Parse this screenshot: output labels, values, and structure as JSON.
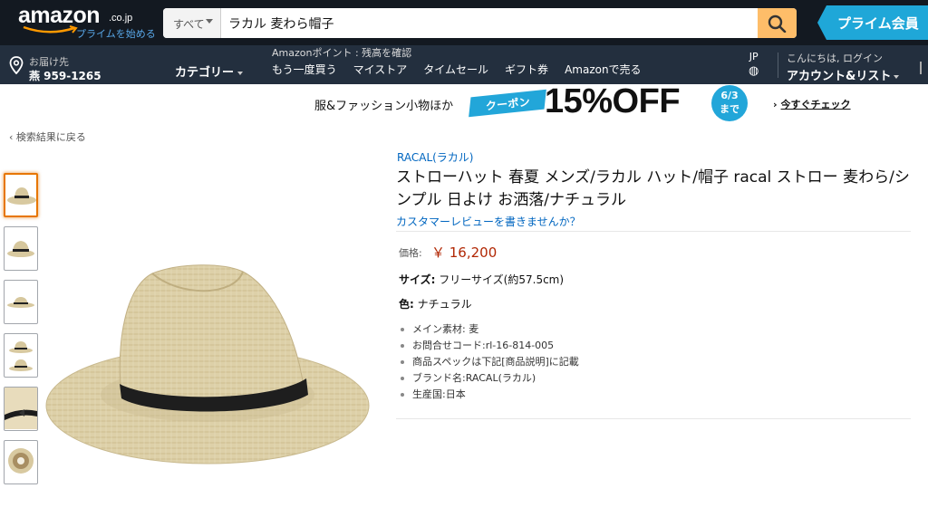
{
  "header": {
    "logo_word": "amazon",
    "logo_tld": ".co.jp",
    "logo_prime_link": "プライムを始める",
    "search_category": "すべて",
    "search_value": "ラカル 麦わら帽子",
    "prime_banner": "プライム会員"
  },
  "subnav": {
    "deliver_label": "お届け先",
    "deliver_value": "燕 959-1265",
    "category_label": "カテゴリー",
    "points": "Amazonポイント : 残高を確認",
    "links": [
      "もう一度買う",
      "マイストア",
      "タイムセール",
      "ギフト券",
      "Amazonで売る"
    ],
    "lang": "JP",
    "greeting": "こんにちは, ログイン",
    "account": "アカウント&リスト"
  },
  "promo": {
    "text": "服&ファッション小物ほか",
    "coupon": "クーポン",
    "discount": "15%OFF",
    "date_line1": "6/3",
    "date_line2": "まで",
    "check": "今すぐチェック"
  },
  "back_link": "‹ 検索結果に戻る",
  "product": {
    "brand": "RACAL(ラカル)",
    "title": "ストローハット 春夏 メンズ/ラカル ハット/帽子 racal ストロー 麦わら/シンプル 日よけ お洒落/ナチュラル",
    "review_link": "カスタマーレビューを書きませんか？",
    "price_label": "価格:",
    "price": "￥ 16,200",
    "size_label": "サイズ:",
    "size_value": "フリーサイズ(約57.5cm)",
    "color_label": "色:",
    "color_value": "ナチュラル",
    "bullets": [
      "メイン素材: 麦",
      "お問合せコード:rl-16-814-005",
      "商品スペックは下記[商品説明]に記載",
      "ブランド名:RACAL(ラカル)",
      "生産国:日本"
    ]
  },
  "colors": {
    "nav_dark": "#131921",
    "nav_sub": "#232f3e",
    "search_button": "#febd69",
    "prime_blue": "#1fa7d8",
    "link": "#0066c0",
    "price": "#b12704",
    "thumb_active": "#e77600"
  }
}
